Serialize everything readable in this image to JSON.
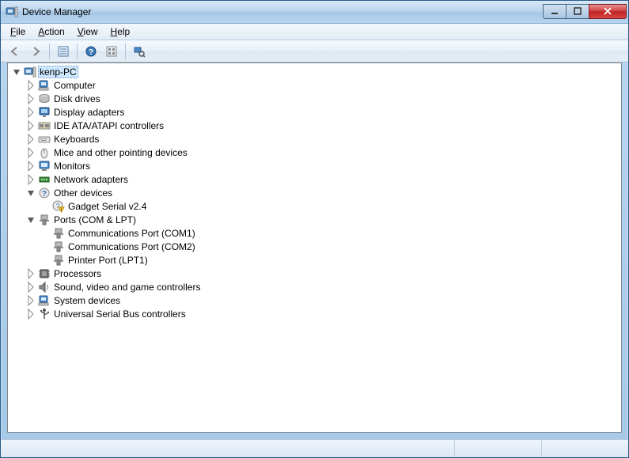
{
  "window": {
    "title": "Device Manager"
  },
  "menu": {
    "file": "File",
    "action": "Action",
    "view": "View",
    "help": "Help"
  },
  "tree": {
    "root": "kenp-PC",
    "computer": "Computer",
    "disk": "Disk drives",
    "display": "Display adapters",
    "ide": "IDE ATA/ATAPI controllers",
    "keyboards": "Keyboards",
    "mice": "Mice and other pointing devices",
    "monitors": "Monitors",
    "network": "Network adapters",
    "other": "Other devices",
    "gadget": "Gadget Serial v2.4",
    "ports": "Ports (COM & LPT)",
    "com1": "Communications Port (COM1)",
    "com2": "Communications Port (COM2)",
    "lpt1": "Printer Port (LPT1)",
    "processors": "Processors",
    "sound": "Sound, video and game controllers",
    "system": "System devices",
    "usb": "Universal Serial Bus controllers"
  }
}
